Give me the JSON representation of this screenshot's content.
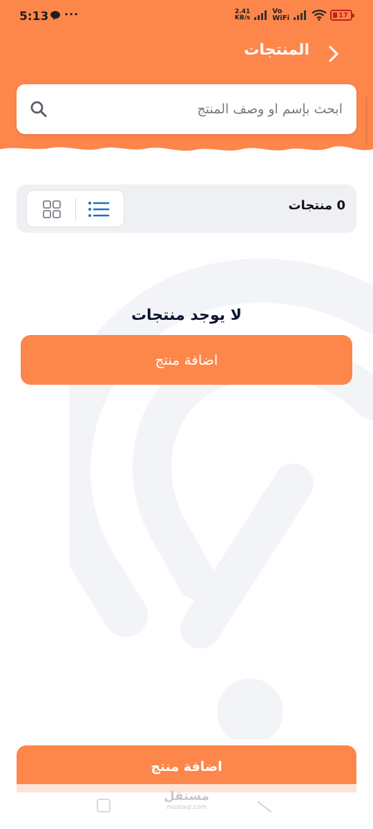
{
  "status_bar": {
    "time": "5:13",
    "more": "···",
    "speed_value": "2.41",
    "speed_unit": "KB/s",
    "vo": "Vo",
    "wifi_label": "WiFi",
    "battery": "17"
  },
  "header": {
    "title": "المنتجات"
  },
  "search": {
    "placeholder": "ابحث بإسم او وصف المنتج"
  },
  "products": {
    "count_label": "0 منتجات"
  },
  "empty_state": {
    "title": "لا يوجد منتجات",
    "add_button": "اضافة منتج"
  },
  "footer": {
    "add_button": "اضافة منتج",
    "watermark_ar": "مستقل",
    "watermark_en": "mostaql.com"
  },
  "colors": {
    "brand_orange": "#fd864b",
    "header_orange": "#fd864b",
    "count_bar_bg": "#eef0f3",
    "list_icon_blue": "#1b6fc2"
  }
}
